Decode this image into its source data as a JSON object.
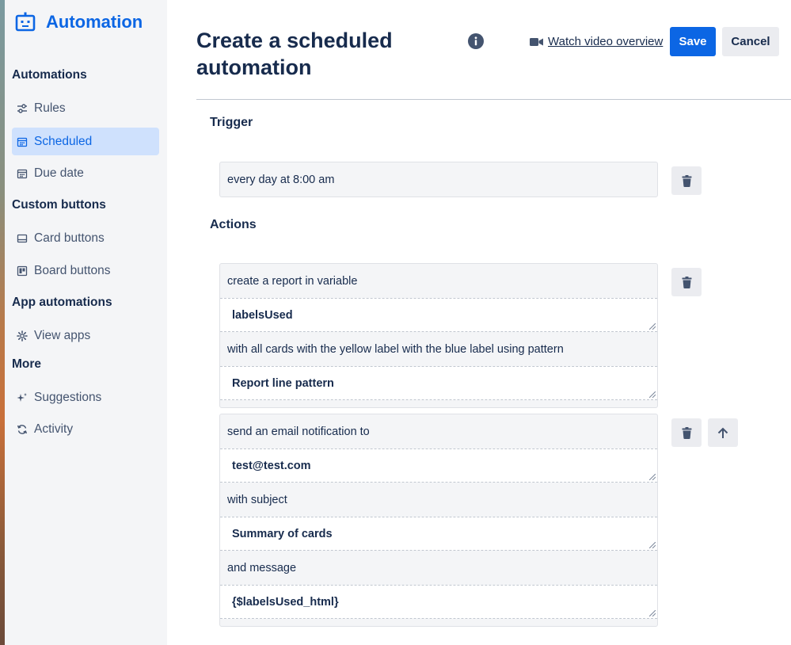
{
  "brand": {
    "title": "Automation"
  },
  "sidebar": {
    "sections": [
      {
        "heading": "Automations"
      },
      {
        "heading": "Custom buttons"
      },
      {
        "heading": "App automations"
      },
      {
        "heading": "More"
      }
    ],
    "items": [
      {
        "label": "Rules",
        "icon": "sliders-icon"
      },
      {
        "label": "Scheduled",
        "icon": "calendar-icon",
        "active": true
      },
      {
        "label": "Due date",
        "icon": "calendar-icon"
      },
      {
        "label": "Card buttons",
        "icon": "card-icon"
      },
      {
        "label": "Board buttons",
        "icon": "board-icon"
      },
      {
        "label": "View apps",
        "icon": "gear-icon"
      },
      {
        "label": "Suggestions",
        "icon": "sparkle-icon"
      },
      {
        "label": "Activity",
        "icon": "refresh-icon"
      }
    ]
  },
  "header": {
    "title": "Create a scheduled automation",
    "video_link": "Watch video overview",
    "save_label": "Save",
    "cancel_label": "Cancel"
  },
  "trigger": {
    "label": "Trigger",
    "text": "every day at 8:00 am"
  },
  "actions": {
    "label": "Actions",
    "items": [
      {
        "text1": "create a report in variable",
        "input1": "labelsUsed",
        "text2": "with all cards with the yellow label with the blue label using pattern",
        "input2": "Report line pattern"
      },
      {
        "text1": "send an email notification to",
        "input1": "test@test.com",
        "text2": "with subject",
        "input2": "Summary of cards",
        "text3": "and message",
        "input3": "{$labelsUsed_html}"
      }
    ]
  },
  "colors": {
    "accent": "#0c66e4",
    "active_bg": "#cfe1fd",
    "sidebar_bg": "#f4f5f7"
  }
}
